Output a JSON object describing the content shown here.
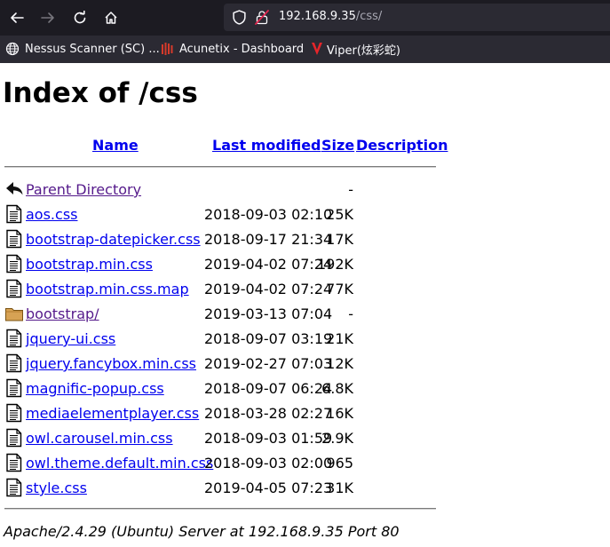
{
  "browser": {
    "url_host": "192.168.9.35",
    "url_path": "/css/",
    "bookmarks": [
      {
        "label": "Nessus Scanner (SC) ...",
        "icon": "globe-icon"
      },
      {
        "label": "Acunetix - Dashboard",
        "icon": "acunetix-icon"
      },
      {
        "label": "Viper(炫彩蛇)",
        "icon": "viper-icon"
      }
    ]
  },
  "page": {
    "title": "Index of /css",
    "columns": {
      "name": "Name",
      "last_modified": "Last modified",
      "size": "Size",
      "description": "Description"
    },
    "rows": [
      {
        "name": "Parent Directory",
        "date": "",
        "size": "-",
        "type": "parent",
        "visited": true
      },
      {
        "name": "aos.css",
        "date": "2018-09-03 02:10",
        "size": "25K",
        "type": "file",
        "visited": false
      },
      {
        "name": "bootstrap-datepicker.css",
        "date": "2018-09-17 21:34",
        "size": "17K",
        "type": "file",
        "visited": false
      },
      {
        "name": "bootstrap.min.css",
        "date": "2019-04-02 07:24",
        "size": "192K",
        "type": "file",
        "visited": false
      },
      {
        "name": "bootstrap.min.css.map",
        "date": "2019-04-02 07:24",
        "size": "77K",
        "type": "file",
        "visited": false
      },
      {
        "name": "bootstrap/",
        "date": "2019-03-13 07:04",
        "size": "-",
        "type": "folder",
        "visited": true
      },
      {
        "name": "jquery-ui.css",
        "date": "2018-09-07 03:19",
        "size": "21K",
        "type": "file",
        "visited": false
      },
      {
        "name": "jquery.fancybox.min.css",
        "date": "2019-02-27 07:03",
        "size": "12K",
        "type": "file",
        "visited": false
      },
      {
        "name": "magnific-popup.css",
        "date": "2018-09-07 06:24",
        "size": "6.8K",
        "type": "file",
        "visited": false
      },
      {
        "name": "mediaelementplayer.css",
        "date": "2018-03-28 02:27",
        "size": "16K",
        "type": "file",
        "visited": false
      },
      {
        "name": "owl.carousel.min.css",
        "date": "2018-09-03 01:59",
        "size": "2.9K",
        "type": "file",
        "visited": false
      },
      {
        "name": "owl.theme.default.min.css",
        "date": "2018-09-03 02:00",
        "size": "965",
        "type": "file",
        "visited": false
      },
      {
        "name": "style.css",
        "date": "2019-04-05 07:23",
        "size": "31K",
        "type": "file",
        "visited": false
      }
    ],
    "footer": "Apache/2.4.29 (Ubuntu) Server at 192.168.9.35 Port 80"
  }
}
